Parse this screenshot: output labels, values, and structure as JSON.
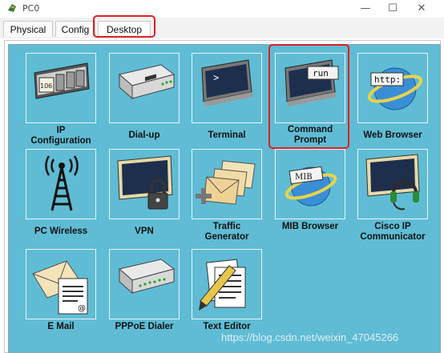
{
  "window": {
    "title": "PC0"
  },
  "tabs": [
    "Physical",
    "Config",
    "Desktop"
  ],
  "apps": [
    {
      "label": "IP\nConfiguration",
      "icon": "ip-config-icon",
      "screen_text": "106"
    },
    {
      "label": "Dial-up",
      "icon": "modem-icon"
    },
    {
      "label": "Terminal",
      "icon": "terminal-icon",
      "screen_text": ">"
    },
    {
      "label": "Command\nPrompt",
      "icon": "command-prompt-icon",
      "screen_text": "run"
    },
    {
      "label": "Web Browser",
      "icon": "web-browser-icon",
      "screen_text": "http:"
    },
    {
      "label": "PC Wireless",
      "icon": "wireless-tower-icon"
    },
    {
      "label": "VPN",
      "icon": "vpn-lock-icon"
    },
    {
      "label": "Traffic\nGenerator",
      "icon": "traffic-generator-icon"
    },
    {
      "label": "MIB Browser",
      "icon": "mib-browser-icon",
      "screen_text": "MIB"
    },
    {
      "label": "Cisco IP\nCommunicator",
      "icon": "ip-communicator-icon"
    },
    {
      "label": "E Mail",
      "icon": "email-icon"
    },
    {
      "label": "PPPoE Dialer",
      "icon": "pppoe-dialer-icon"
    },
    {
      "label": "Text Editor",
      "icon": "text-editor-icon"
    }
  ],
  "watermark": "https://blog.csdn.net/weixin_47045266"
}
